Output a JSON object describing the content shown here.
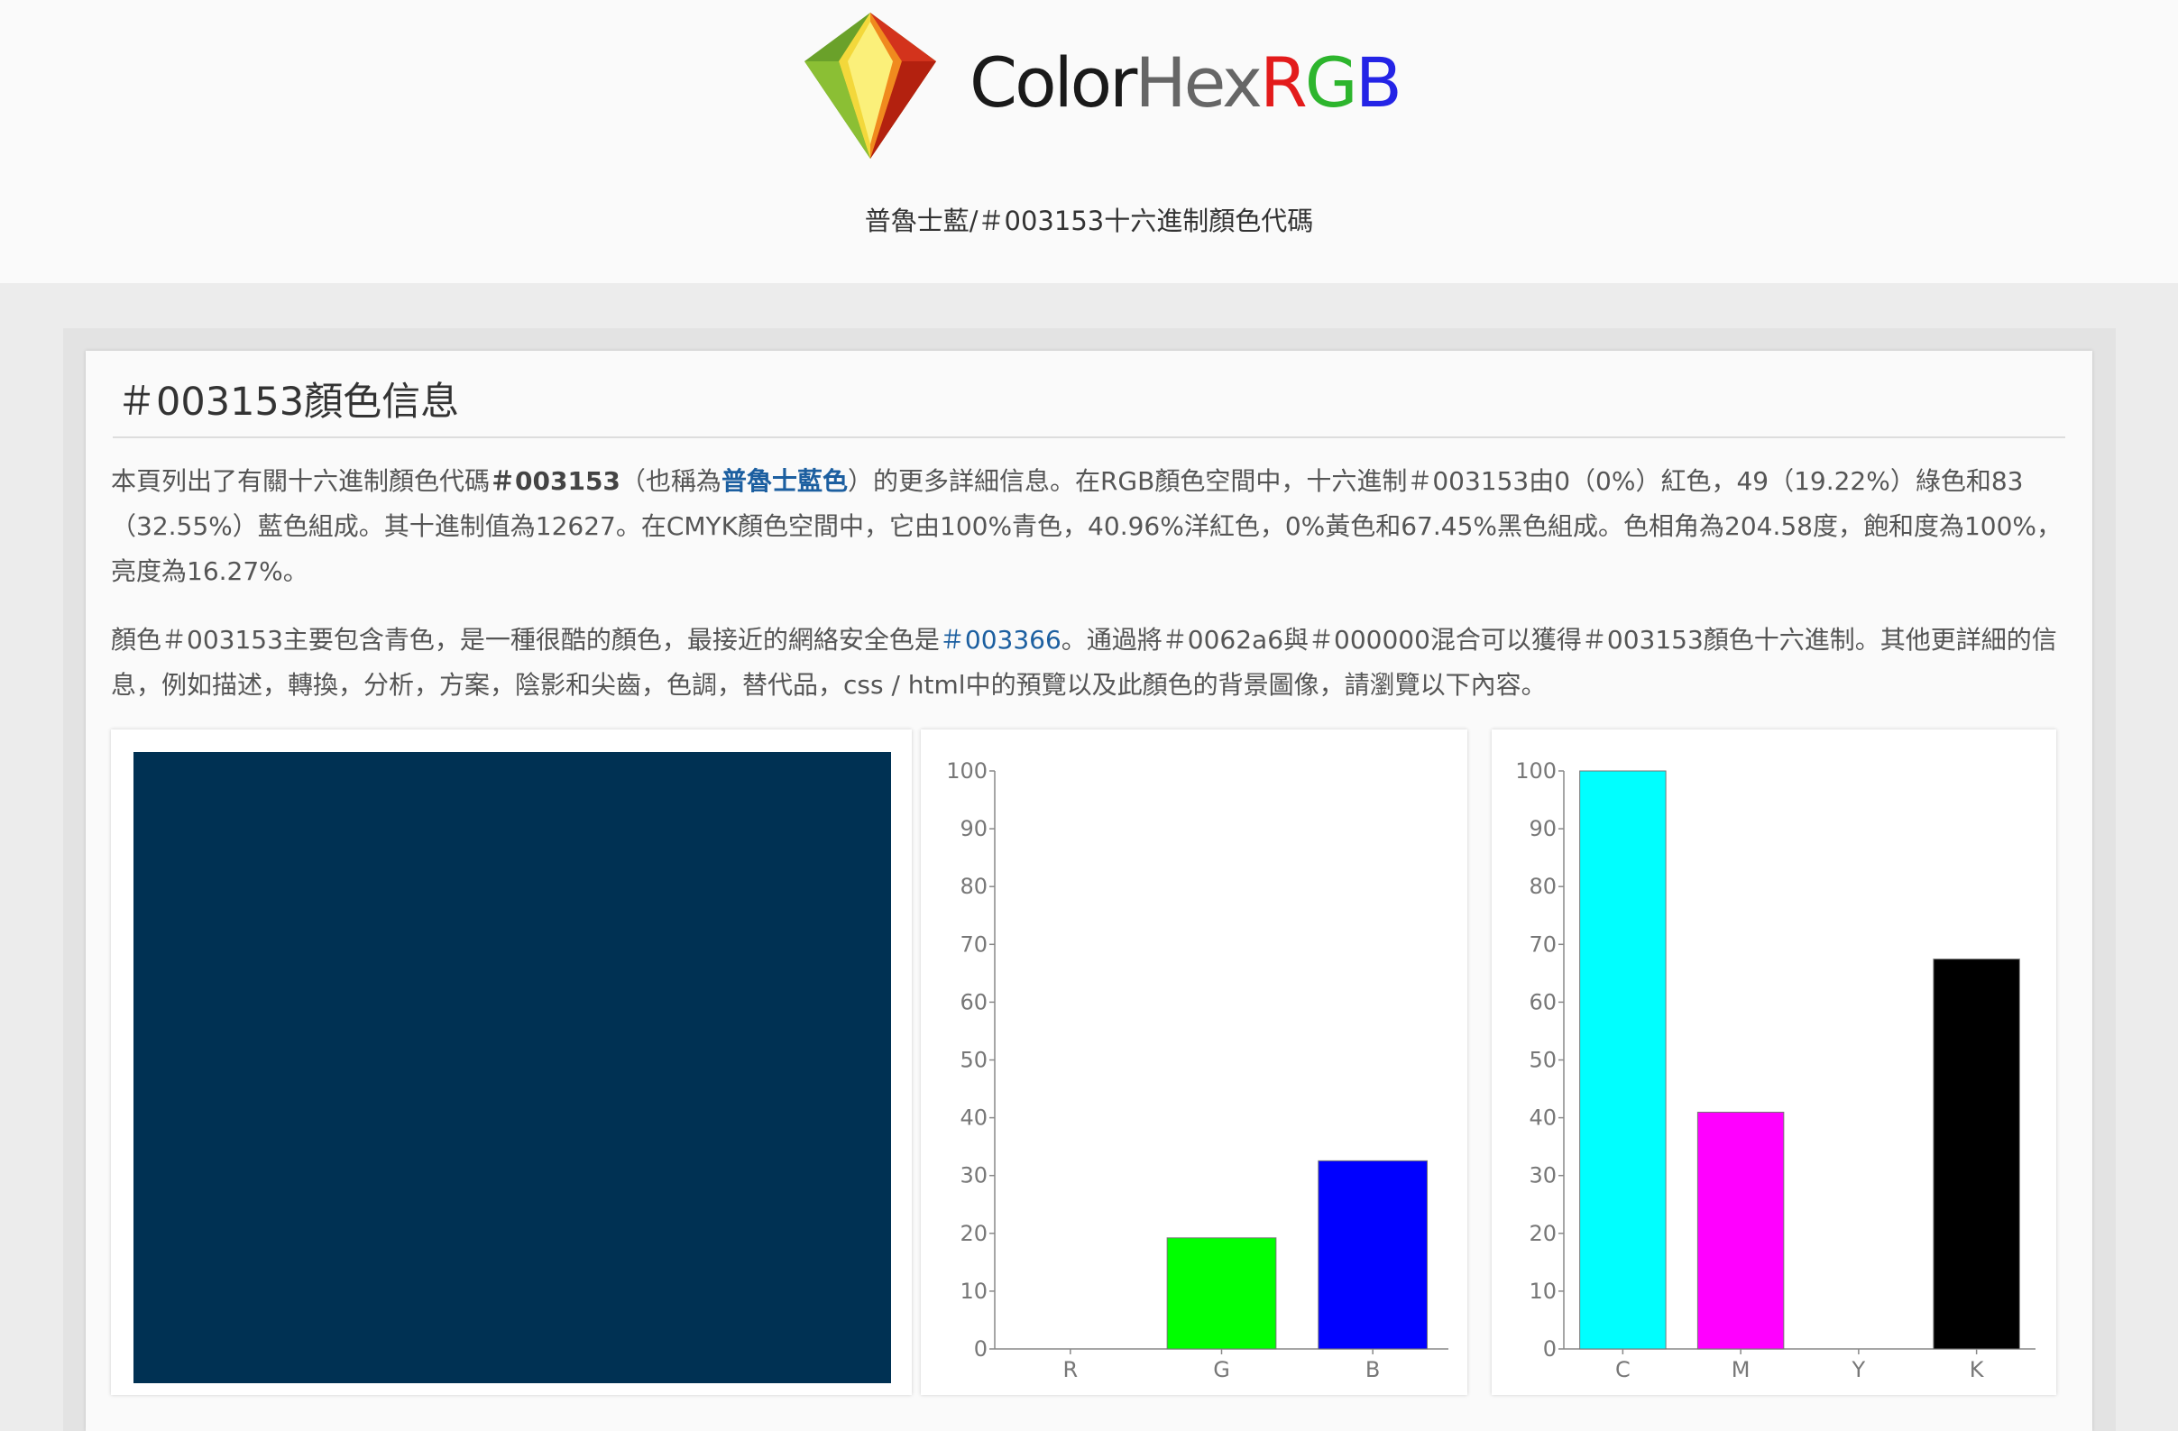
{
  "brand": {
    "part1": "Color",
    "part2": "Hex",
    "r": "R",
    "g": "G",
    "b": "B"
  },
  "subtitle": "普魯士藍/＃003153十六進制顏色代碼",
  "card": {
    "title": "＃003153顏色信息",
    "p1": {
      "pre": "本頁列出了有關十六進制顏色代碼",
      "hex_bold": "＃003153",
      "mid": "（也稱為",
      "name_link": "普魯士藍色",
      "post": "）的更多詳細信息。在RGB顏色空間中，十六進制＃003153由0（0%）紅色，49（19.22%）綠色和83（32.55%）藍色組成。其十進制值為12627。在CMYK顏色空間中，它由100%青色，40.96%洋紅色，0%黃色和67.45%黑色組成。色相角為204.58度，飽和度為100%，亮度為16.27%。"
    },
    "p2": {
      "pre": "顏色＃003153主要包含青色，是一種很酷的顏色，最接近的網絡安全色是",
      "safe_link": "＃003366",
      "post": "。通過將＃0062a6與＃000000混合可以獲得＃003153顏色十六進制。其他更詳細的信息，例如描述，轉換，分析，方案，陰影和尖齒，色調，替代品，css / html中的預覽以及此顏色的背景圖像，請瀏覽以下內容。"
    }
  },
  "colors": {
    "swatch": "#003153"
  },
  "chart_data": [
    {
      "type": "bar",
      "categories": [
        "R",
        "G",
        "B"
      ],
      "values": [
        0,
        19.22,
        32.55
      ],
      "colors": [
        "#ff0000",
        "#00ff00",
        "#0000ff"
      ],
      "ylim": [
        0,
        100
      ],
      "yticks": [
        0,
        10,
        20,
        30,
        40,
        50,
        60,
        70,
        80,
        90,
        100
      ]
    },
    {
      "type": "bar",
      "categories": [
        "C",
        "M",
        "Y",
        "K"
      ],
      "values": [
        100,
        40.96,
        0,
        67.45
      ],
      "colors": [
        "#00ffff",
        "#ff00ff",
        "#ffff00",
        "#000000"
      ],
      "ylim": [
        0,
        100
      ],
      "yticks": [
        0,
        10,
        20,
        30,
        40,
        50,
        60,
        70,
        80,
        90,
        100
      ]
    }
  ]
}
